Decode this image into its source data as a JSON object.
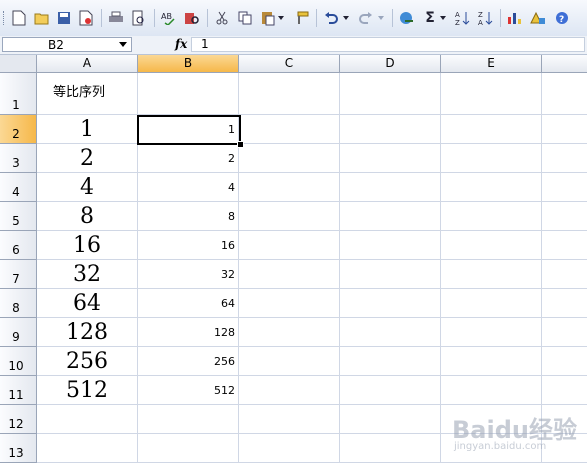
{
  "formula_bar": {
    "name_box": "B2",
    "fx_label": "fx",
    "content": "1"
  },
  "columns": [
    "A",
    "B",
    "C",
    "D",
    "E"
  ],
  "rows": [
    "1",
    "2",
    "3",
    "4",
    "5",
    "6",
    "7",
    "8",
    "9",
    "10",
    "11",
    "12",
    "13"
  ],
  "cells": {
    "A1": "等比序列",
    "A": [
      "1",
      "2",
      "4",
      "8",
      "16",
      "32",
      "64",
      "128",
      "256",
      "512"
    ],
    "B": [
      "1",
      "2",
      "4",
      "8",
      "16",
      "32",
      "64",
      "128",
      "256",
      "512"
    ]
  },
  "selected_cell": "B2",
  "watermark": {
    "brand": "Baidu经验",
    "url": "jingyan.baidu.com"
  },
  "colors": {
    "selected_header": "#f6b84a",
    "gridline": "#d0d7e5",
    "header_bg": "#e4e8ef"
  },
  "toolbar_icons": [
    "new-icon",
    "open-icon",
    "save-icon",
    "permission-icon",
    "print-icon",
    "print-preview-icon",
    "spelling-icon",
    "research-icon",
    "cut-icon",
    "copy-icon",
    "paste-icon",
    "format-painter-icon",
    "undo-icon",
    "redo-icon",
    "hyperlink-icon",
    "autosum-icon",
    "sort-ascending-icon",
    "sort-descending-icon",
    "chart-wizard-icon",
    "drawing-icon",
    "help-icon"
  ]
}
